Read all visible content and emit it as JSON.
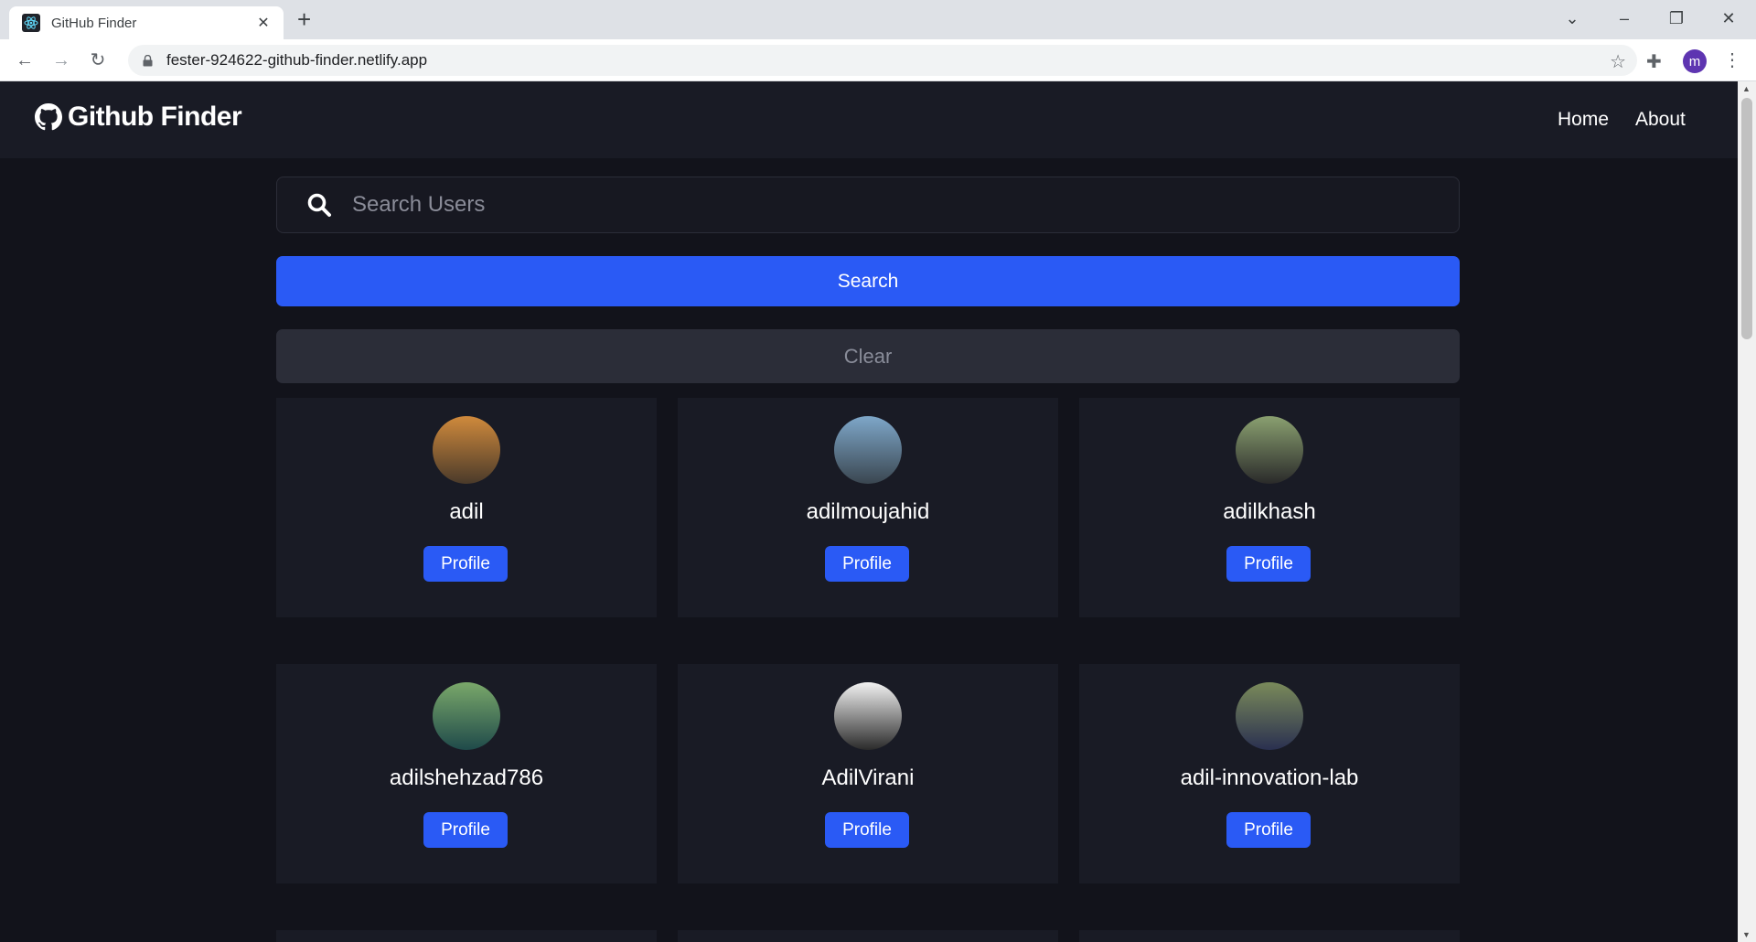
{
  "browser": {
    "tab_title": "GitHub Finder",
    "url": "fester-924622-github-finder.netlify.app",
    "profile_initial": "m"
  },
  "navbar": {
    "brand": "Github Finder",
    "links": [
      "Home",
      "About"
    ]
  },
  "search": {
    "placeholder": "Search Users",
    "value": "",
    "search_label": "Search",
    "clear_label": "Clear"
  },
  "users": [
    {
      "login": "adil",
      "profile_label": "Profile",
      "colors": [
        "#d08a3c",
        "#4a3a2a"
      ]
    },
    {
      "login": "adilmoujahid",
      "profile_label": "Profile",
      "colors": [
        "#7ea7c9",
        "#3a4650"
      ]
    },
    {
      "login": "adilkhash",
      "profile_label": "Profile",
      "colors": [
        "#8aa070",
        "#2a2a2a"
      ]
    },
    {
      "login": "adilshehzad786",
      "profile_label": "Profile",
      "colors": [
        "#7aa86a",
        "#1f4a4a"
      ]
    },
    {
      "login": "AdilVirani",
      "profile_label": "Profile",
      "colors": [
        "#f2f2f2",
        "#2a2a2a"
      ]
    },
    {
      "login": "adil-innovation-lab",
      "profile_label": "Profile",
      "colors": [
        "#7a8a5a",
        "#2a3050"
      ]
    }
  ],
  "colors": {
    "background": "#12131b",
    "navbar": "#191b25",
    "accent": "#2a5af5",
    "card": "#191b25"
  }
}
